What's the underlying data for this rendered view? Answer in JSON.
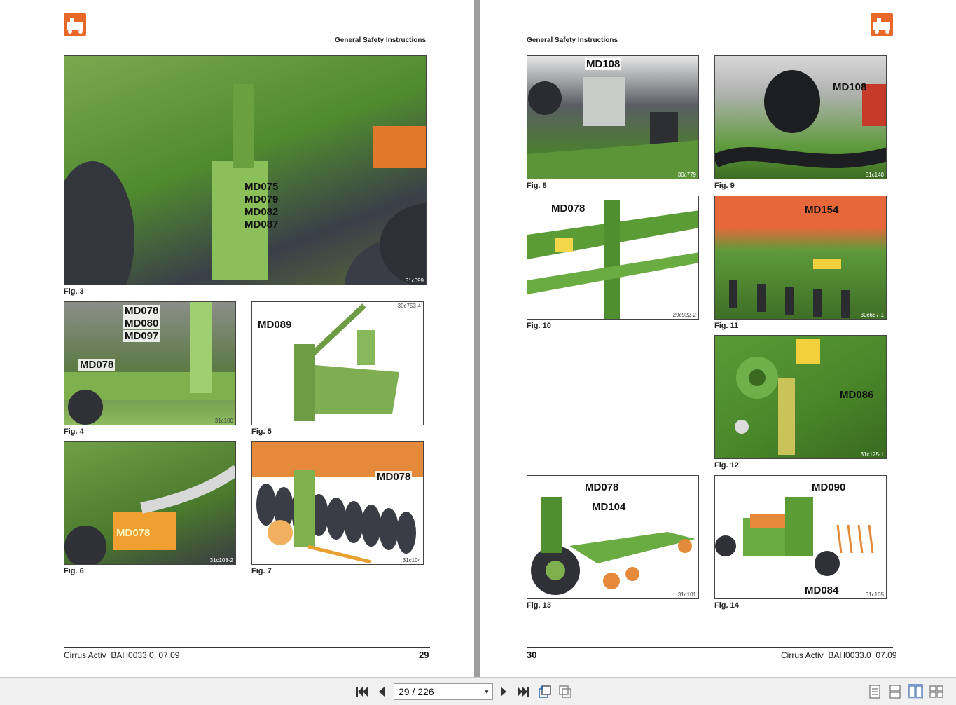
{
  "viewer": {
    "left_page": {
      "section_title": "General Safety Instructions",
      "footer_left": "Cirrus Activ  BAH0033.0  07.09",
      "page_number": "29",
      "figures": [
        {
          "caption": "Fig. 3",
          "code": "31c099",
          "labels": [
            "MD075",
            "MD079",
            "MD082",
            "MD087"
          ]
        },
        {
          "caption": "Fig. 4",
          "code": "31c100",
          "labels": [
            "MD078",
            "MD080",
            "MD097",
            "MD078"
          ]
        },
        {
          "caption": "Fig. 5",
          "code": "30c753-4",
          "labels": [
            "MD089"
          ]
        },
        {
          "caption": "Fig. 6",
          "code": "31c108-2",
          "labels": [
            "MD078"
          ]
        },
        {
          "caption": "Fig. 7",
          "code": "31c104",
          "labels": [
            "MD078"
          ]
        }
      ]
    },
    "right_page": {
      "section_title": "General Safety Instructions",
      "footer_right": "Cirrus Activ  BAH0033.0  07.09",
      "page_number": "30",
      "figures": [
        {
          "caption": "Fig. 8",
          "code": "30c779",
          "labels": [
            "MD108"
          ]
        },
        {
          "caption": "Fig. 9",
          "code": "31c140",
          "labels": [
            "MD108"
          ]
        },
        {
          "caption": "Fig. 10",
          "code": "29c922-2",
          "labels": [
            "MD078"
          ]
        },
        {
          "caption": "Fig. 11",
          "code": "30c687-1",
          "labels": [
            "MD154"
          ]
        },
        {
          "caption": "Fig. 12",
          "code": "31c125-1",
          "labels": [
            "MD086"
          ]
        },
        {
          "caption": "Fig. 13",
          "code": "31c101",
          "labels": [
            "MD078",
            "MD104"
          ]
        },
        {
          "caption": "Fig. 14",
          "code": "31c105",
          "labels": [
            "MD090",
            "MD084"
          ]
        }
      ]
    }
  },
  "toolbar": {
    "current_page": "29",
    "separator": "/",
    "total_pages": "226",
    "icons": [
      "first-page-icon",
      "previous-page-icon",
      "next-page-icon",
      "last-page-icon",
      "rotate-icon",
      "fit-icon",
      "single-page-icon",
      "continuous-icon",
      "two-page-icon",
      "outline-icon"
    ]
  },
  "colors": {
    "brand": "#e8682a",
    "machine_green": "#5f9a3a",
    "toolbar_bg": "#f0f0f0"
  }
}
